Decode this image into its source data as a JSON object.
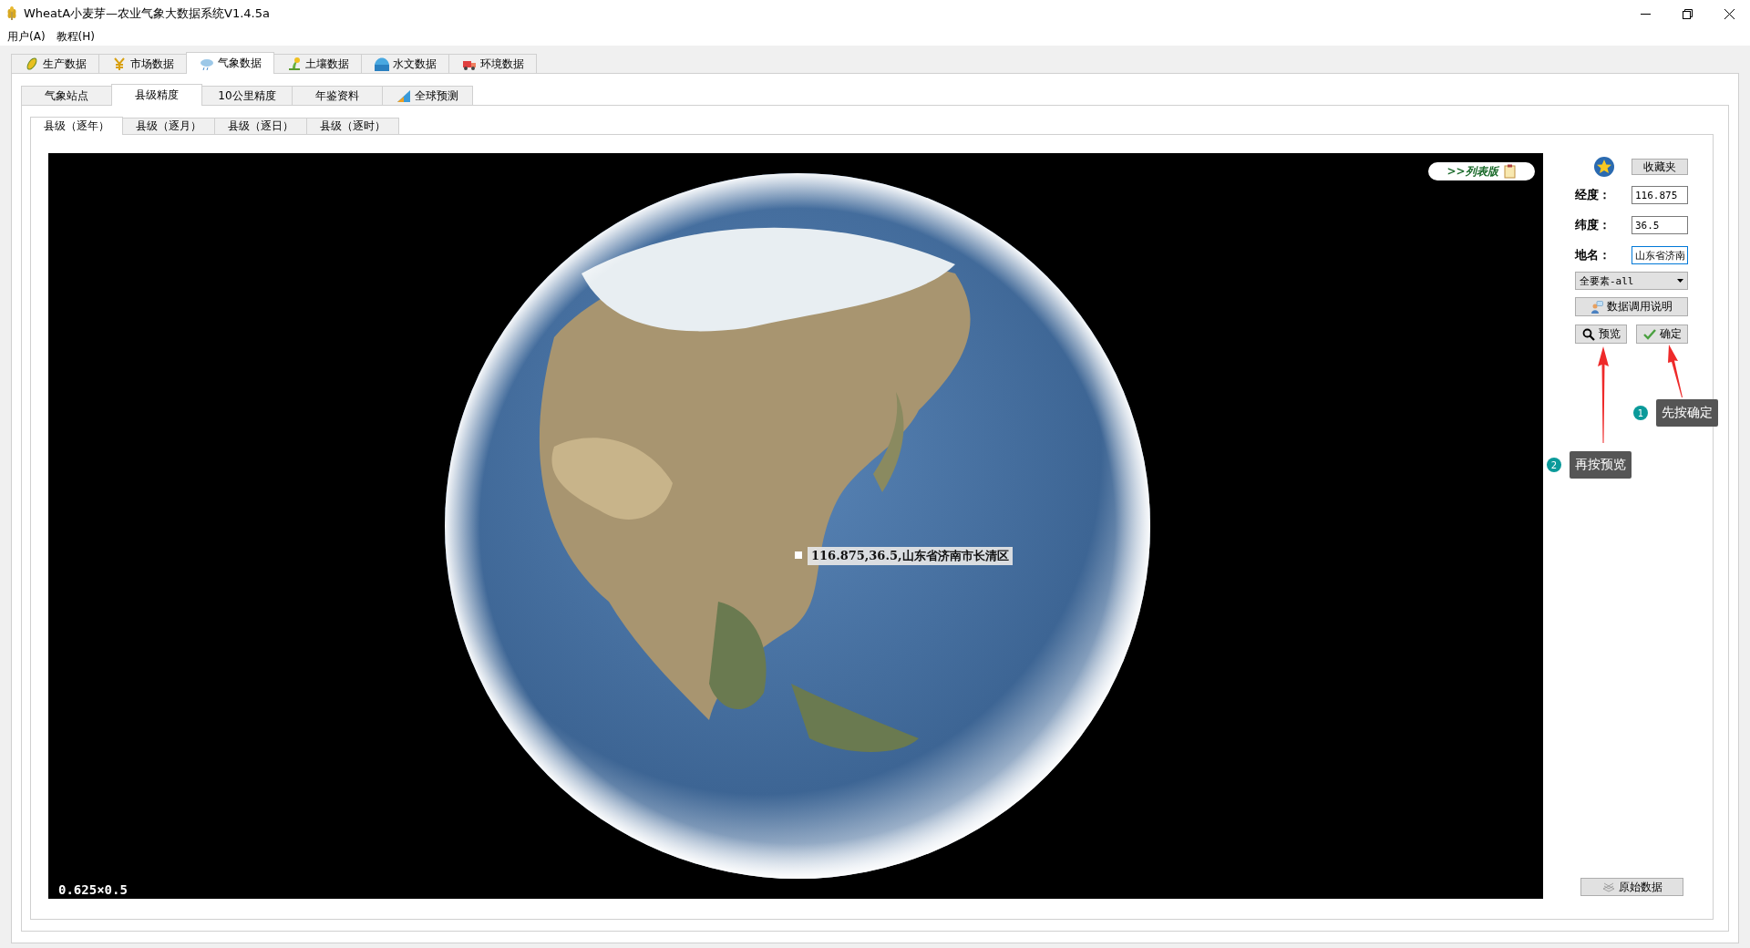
{
  "window": {
    "title": "WheatA小麦芽—农业气象大数据系统V1.4.5a"
  },
  "menu": [
    "用户(A)",
    "教程(H)"
  ],
  "main_tabs": [
    {
      "label": "生产数据",
      "selected": false
    },
    {
      "label": "市场数据",
      "selected": false
    },
    {
      "label": "气象数据",
      "selected": true
    },
    {
      "label": "土壤数据",
      "selected": false
    },
    {
      "label": "水文数据",
      "selected": false
    },
    {
      "label": "环境数据",
      "selected": false
    }
  ],
  "sub_tabs": [
    {
      "label": "气象站点",
      "selected": false
    },
    {
      "label": "县级精度",
      "selected": true
    },
    {
      "label": "10公里精度",
      "selected": false
    },
    {
      "label": "年鉴资料",
      "selected": false
    },
    {
      "label": "全球预测",
      "selected": false
    }
  ],
  "level_tabs": [
    {
      "label": "县级（逐年）",
      "selected": true
    },
    {
      "label": "县级（逐月）",
      "selected": false
    },
    {
      "label": "县级（逐日）",
      "selected": false
    },
    {
      "label": "县级（逐时）",
      "selected": false
    }
  ],
  "map": {
    "list_button": ">>列表版",
    "location_label": "116.875,36.5,山东省济南市长清区",
    "scale": "0.625×0.5"
  },
  "panel": {
    "favorites_button": "收藏夹",
    "fields": [
      {
        "label": "经度：",
        "value": "116.875"
      },
      {
        "label": "纬度：",
        "value": "36.5"
      },
      {
        "label": "地名：",
        "value": "山东省济南"
      }
    ],
    "dropdown": "全要素-all",
    "help_button": "数据调用说明",
    "preview_button": "预览",
    "confirm_button": "确定",
    "raw_data_button": "原始数据"
  },
  "annotations": [
    {
      "number": "1",
      "text": "先按确定"
    },
    {
      "number": "2",
      "text": "再按预览"
    }
  ]
}
